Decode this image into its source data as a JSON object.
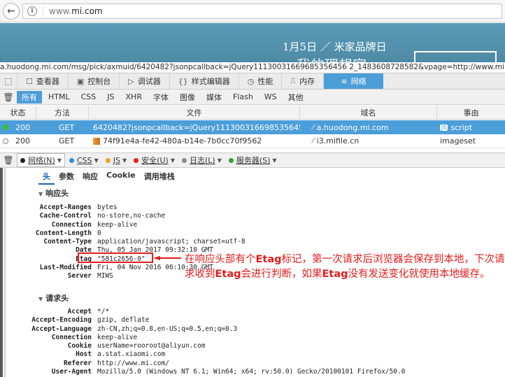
{
  "browser": {
    "url_prefix": "www.",
    "url_domain": "mi.com"
  },
  "banner": {
    "headline": "1月5日 ／ 米家品牌日",
    "bigtext": "我的理想家"
  },
  "request_url": "a.huodong.mi.com/msg/pick/axmuid/6420482?jsonpcallback=jQuery11130031669685356456 2_1483608728582&vpage=http://www.mi.com/&_=",
  "devtools": {
    "tabs": [
      {
        "icon": "☐",
        "label": "查看器"
      },
      {
        "icon": "▣",
        "label": "控制台"
      },
      {
        "icon": "▷",
        "label": "调试器"
      },
      {
        "icon": "{}",
        "label": "样式编辑器"
      },
      {
        "icon": "◷",
        "label": "性能"
      },
      {
        "icon": "⎍",
        "label": "内存"
      },
      {
        "icon": "≡",
        "label": "网络"
      }
    ],
    "filters": [
      "所有",
      "HTML",
      "CSS",
      "JS",
      "XHR",
      "字体",
      "图像",
      "媒体",
      "Flash",
      "WS",
      "其他"
    ]
  },
  "table": {
    "headers": {
      "status": "状态",
      "method": "方法",
      "file": "文件",
      "domain": "域名",
      "cause": "事由"
    },
    "rows": [
      {
        "status": "200",
        "method": "GET",
        "file": "6420482?jsonpcallback=jQuery1113003166985356456 2_...",
        "domain": "a.huodong.mi.com",
        "cause": "script",
        "dot_color": "#2fc32f"
      },
      {
        "status": "200",
        "method": "GET",
        "file": "74f91e4a-fe42-480a-b14e-7b0cc70f9562",
        "domain": "i3.mifile.cn",
        "cause": "imageset",
        "dot_color": "#ffffff"
      }
    ]
  },
  "console_filters": [
    {
      "label": "网络(N)",
      "color": "#222222"
    },
    {
      "label": "CSS",
      "color": "#2a8de0"
    },
    {
      "label": "JS",
      "color": "#f0a020"
    },
    {
      "label": "安全(U)",
      "color": "#e52020"
    },
    {
      "label": "日志(L)",
      "color": "#888888"
    },
    {
      "label": "服务器(S)",
      "color": "#2fa52f"
    }
  ],
  "detail": {
    "tabs": [
      "头",
      "参数",
      "响应",
      "Cookie",
      "调用堆栈"
    ],
    "response_title": "响应头",
    "response_headers": [
      {
        "k": "Accept-Ranges",
        "v": "bytes"
      },
      {
        "k": "Cache-Control",
        "v": "no-store,no-cache"
      },
      {
        "k": "Connection",
        "v": "keep-alive"
      },
      {
        "k": "Content-Length",
        "v": "0"
      },
      {
        "k": "Content-Type",
        "v": "application/javascript; charset=utf-8"
      },
      {
        "k": "Date",
        "v": "Thu, 05 Jan 2017 09:32:10 GMT"
      },
      {
        "k": "Etag",
        "v": "\"581c2656-0\""
      },
      {
        "k": "Last-Modified",
        "v": "Fri, 04 Nov 2016 06:10:30 GMT"
      },
      {
        "k": "Server",
        "v": "MIWS"
      }
    ],
    "request_title": "请求头",
    "request_headers": [
      {
        "k": "Accept",
        "v": "*/*"
      },
      {
        "k": "Accept-Encoding",
        "v": "gzip, deflate"
      },
      {
        "k": "Accept-Language",
        "v": "zh-CN,zh;q=0.8,en-US;q=0.5,en;q=0.3"
      },
      {
        "k": "Connection",
        "v": "keep-alive"
      },
      {
        "k": "Cookie",
        "v": "userName=rooroot@aliyun.com"
      },
      {
        "k": "Host",
        "v": "a.stat.xiaomi.com"
      },
      {
        "k": "Referer",
        "v": "http://www.mi.com/"
      },
      {
        "k": "User-Agent",
        "v": "Mozilla/5.0 (Windows NT 6.1; Win64; x64; rv:50.0) Gecko/20100101 Firefox/50.0"
      }
    ]
  },
  "annotation": {
    "p1": "在响应头部有个",
    "k1": "Etag",
    "p2": "标记，第一次请求后浏览器会保存到本地，下次请求收到",
    "k2": "Etag",
    "p3": "会进行判断，如果",
    "k3": "Etag",
    "p4": "没有发送变化就使用本地缓存。"
  }
}
